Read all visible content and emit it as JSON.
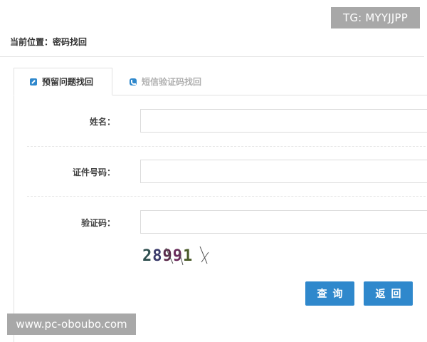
{
  "watermarks": {
    "top": "TG: MYYJJPP",
    "bottom": "www.pc-oboubo.com"
  },
  "breadcrumb": "当前位置：密码找回",
  "tabs": [
    {
      "label": "预留问题找回",
      "icon": "edit-icon",
      "active": true
    },
    {
      "label": "短信验证码找回",
      "icon": "phone-icon",
      "active": false
    }
  ],
  "form": {
    "name_label": "姓名：",
    "name_value": "",
    "id_label": "证件号码：",
    "id_value": "",
    "captcha_label": "验证码：",
    "captcha_value": "",
    "captcha_text": "28991"
  },
  "buttons": {
    "query": "查询",
    "back": "返回"
  },
  "colors": {
    "accent": "#2f88cc",
    "tab_inactive_text": "#b0b0b0"
  }
}
